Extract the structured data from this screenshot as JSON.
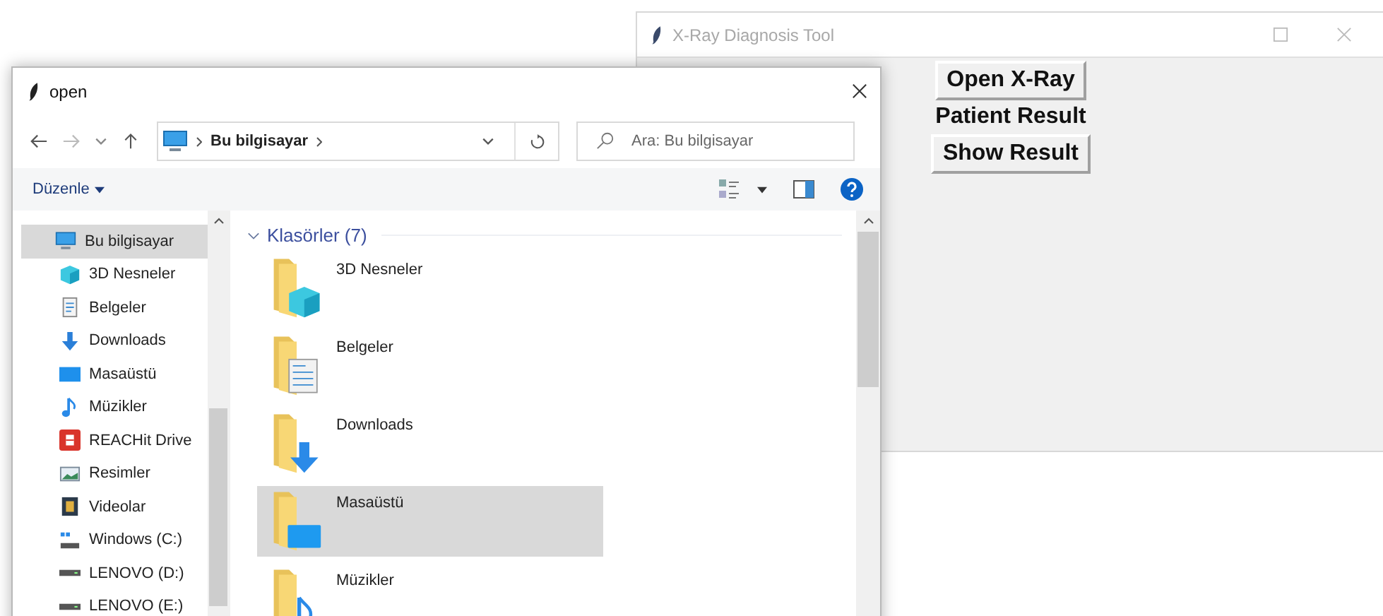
{
  "app_window": {
    "title": "X-Ray Diagnosis Tool",
    "widgets": [
      {
        "kind": "button",
        "label": "Open X-Ray"
      },
      {
        "kind": "label",
        "label": "Patient Result"
      },
      {
        "kind": "button",
        "label": "Show Result"
      }
    ]
  },
  "dialog": {
    "title": "open",
    "address": "Bu bilgisayar",
    "search": {
      "placeholder": "Ara: Bu bilgisayar"
    },
    "organize": "Düzenle",
    "sidebar": {
      "items": [
        {
          "label": "Bu bilgisayar",
          "kind": "computer",
          "selected": true,
          "children": [
            {
              "label": "3D Nesneler",
              "kind": "cube",
              "selected": false
            },
            {
              "label": "Belgeler",
              "kind": "document",
              "selected": false
            },
            {
              "label": "Downloads",
              "kind": "download",
              "selected": false
            },
            {
              "label": "Masaüstü",
              "kind": "desktop",
              "selected": false
            },
            {
              "label": "Müzikler",
              "kind": "music",
              "selected": false
            },
            {
              "label": "REACHit Drive",
              "kind": "cloud-drive",
              "selected": false
            },
            {
              "label": "Resimler",
              "kind": "pictures",
              "selected": false
            },
            {
              "label": "Videolar",
              "kind": "video",
              "selected": false
            },
            {
              "label": "Windows (C:)",
              "kind": "system-drive",
              "selected": false
            },
            {
              "label": "LENOVO (D:)",
              "kind": "drive",
              "selected": false
            },
            {
              "label": "LENOVO (E:)",
              "kind": "drive",
              "selected": false
            }
          ]
        }
      ]
    },
    "group": {
      "label": "Klasörler (7)",
      "expanded": true
    },
    "folders": [
      {
        "label": "3D Nesneler",
        "kind": "cube",
        "selected": false
      },
      {
        "label": "Belgeler",
        "kind": "document",
        "selected": false
      },
      {
        "label": "Downloads",
        "kind": "download",
        "selected": false
      },
      {
        "label": "Masaüstü",
        "kind": "desktop",
        "selected": true
      },
      {
        "label": "Müzikler",
        "kind": "music",
        "selected": false
      }
    ]
  }
}
